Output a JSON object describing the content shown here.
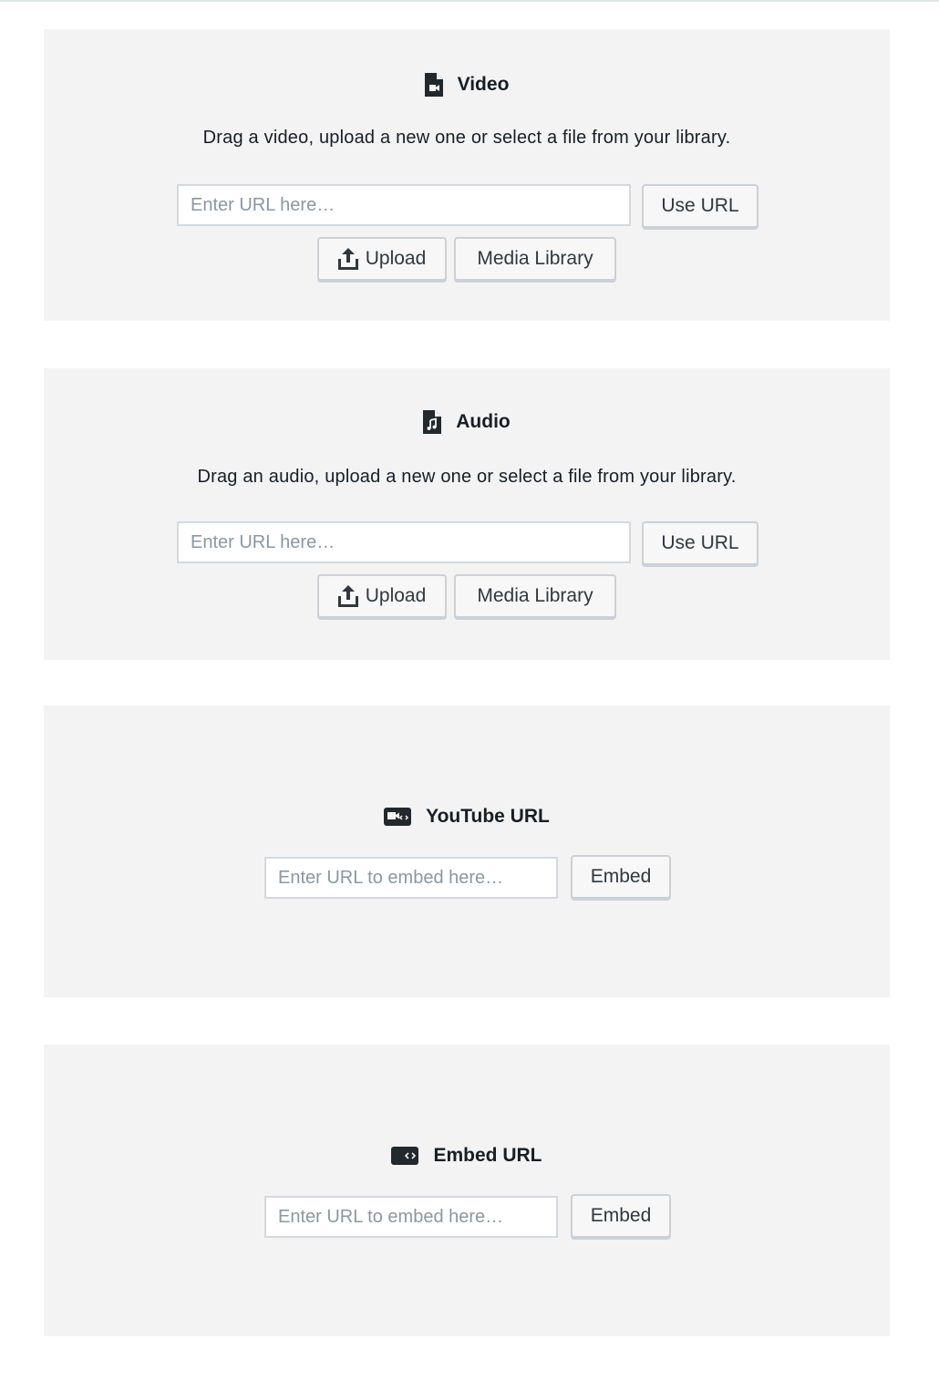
{
  "video": {
    "title": "Video",
    "icon": "video-file-icon",
    "instructions": "Drag a video, upload a new one or select a file from your library.",
    "url_placeholder": "Enter URL here…",
    "use_url_label": "Use URL",
    "upload_label": "Upload",
    "media_library_label": "Media Library"
  },
  "audio": {
    "title": "Audio",
    "icon": "audio-file-icon",
    "instructions": "Drag an audio, upload a new one or select a file from your library.",
    "url_placeholder": "Enter URL here…",
    "use_url_label": "Use URL",
    "upload_label": "Upload",
    "media_library_label": "Media Library"
  },
  "youtube": {
    "title": "YouTube URL",
    "icon": "video-embed-icon",
    "url_placeholder": "Enter URL to embed here…",
    "embed_label": "Embed"
  },
  "embed": {
    "title": "Embed URL",
    "icon": "embed-icon",
    "url_placeholder": "Enter URL to embed here…",
    "embed_label": "Embed"
  },
  "colors": {
    "placeholder_bg": "#f3f3f4",
    "text": "#191e23",
    "button_border": "#cdd0d4"
  }
}
